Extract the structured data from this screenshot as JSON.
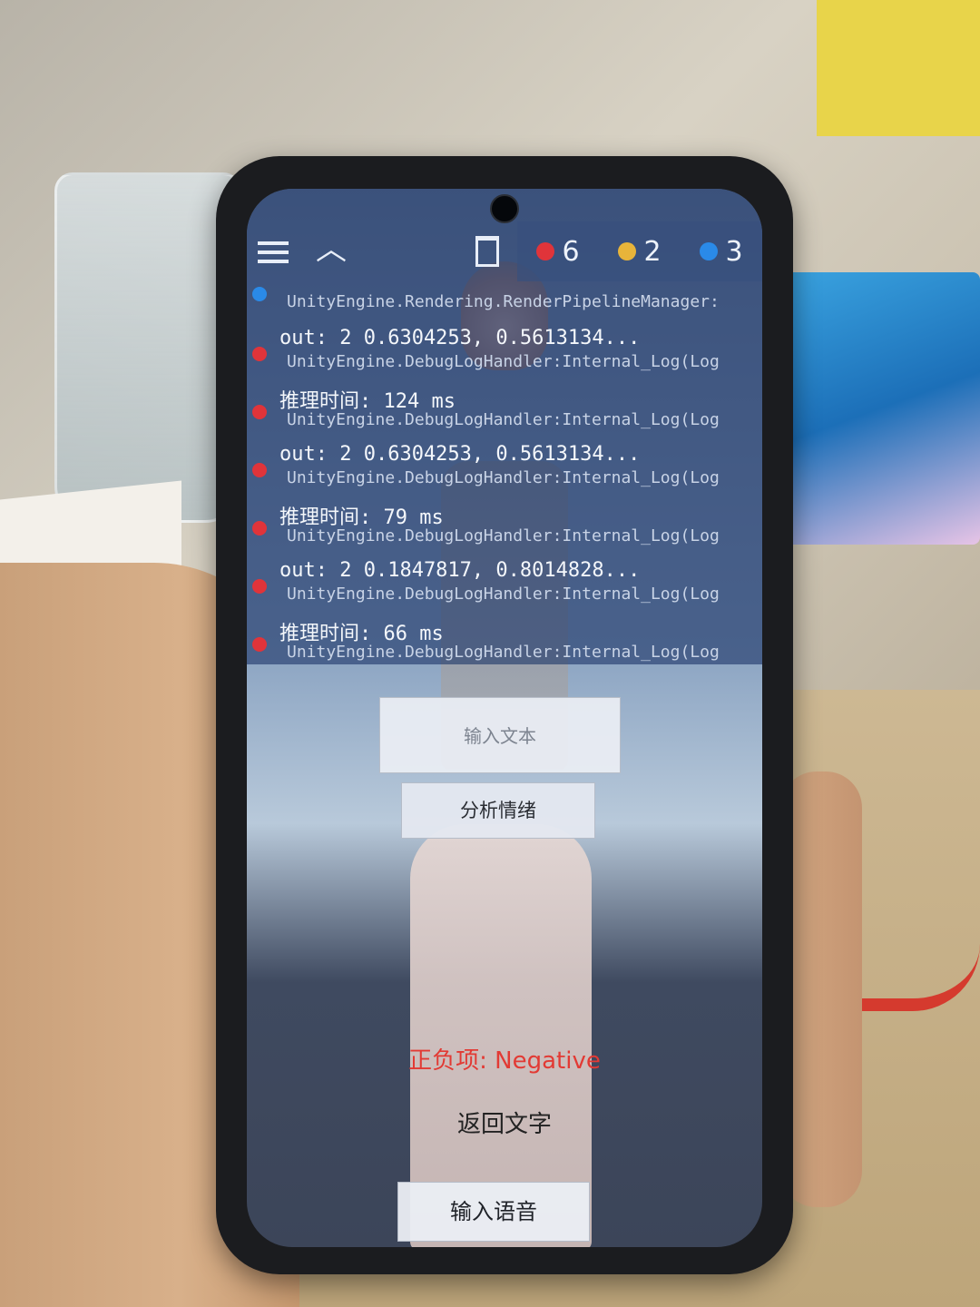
{
  "console": {
    "tabs": [
      {
        "icon": "error-dot",
        "color": "#e0343a",
        "count": "6"
      },
      {
        "icon": "warning-dot",
        "color": "#e8b43a",
        "count": "2"
      },
      {
        "icon": "info-dot",
        "color": "#2a8ae8",
        "count": "3"
      }
    ],
    "partial_entry": {
      "stack": "UnityEngine.Rendering.RenderPipelineManager:",
      "color": "#2a8ae8"
    },
    "entries": [
      {
        "message": "out: 2  0.6304253, 0.5613134...",
        "stack": "UnityEngine.DebugLogHandler:Internal_Log(Log",
        "color": "#e0343a"
      },
      {
        "message": "推理时间: 124 ms",
        "stack": "UnityEngine.DebugLogHandler:Internal_Log(Log",
        "color": "#e0343a"
      },
      {
        "message": "out: 2  0.6304253, 0.5613134...",
        "stack": "UnityEngine.DebugLogHandler:Internal_Log(Log",
        "color": "#e0343a"
      },
      {
        "message": "推理时间: 79 ms",
        "stack": "UnityEngine.DebugLogHandler:Internal_Log(Log",
        "color": "#e0343a"
      },
      {
        "message": "out: 2  0.1847817, 0.8014828...",
        "stack": "UnityEngine.DebugLogHandler:Internal_Log(Log",
        "color": "#e0343a"
      },
      {
        "message": "推理时间: 66 ms",
        "stack": "UnityEngine.DebugLogHandler:Internal_Log(Log",
        "color": "#e0343a"
      }
    ]
  },
  "app": {
    "input_placeholder": "输入文本",
    "analyze_button": "分析情绪",
    "result_label": "正负项: Negative",
    "return_text": "返回文字",
    "voice_button": "输入语音"
  }
}
